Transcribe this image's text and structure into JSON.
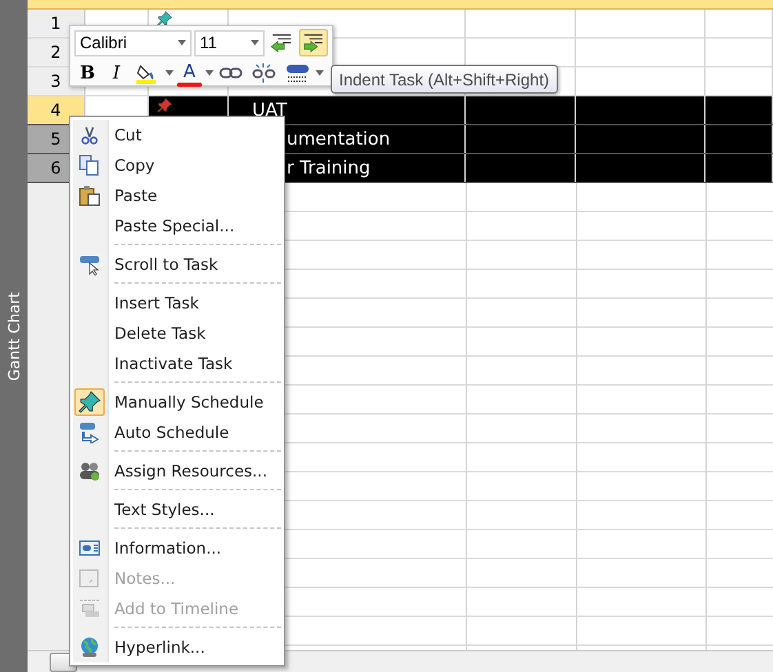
{
  "side_tab": {
    "label": "Gantt Chart"
  },
  "table": {
    "rows": [
      {
        "number": "1",
        "kind": "pinned",
        "selected": false,
        "active": false
      },
      {
        "number": "2",
        "selected": false,
        "active": false
      },
      {
        "number": "3",
        "selected": false,
        "active": false
      },
      {
        "number": "4",
        "kind": "pinned-warning",
        "name": "UAT",
        "selected": true,
        "active": true
      },
      {
        "number": "5",
        "name": "umentation",
        "selected": true,
        "active": false
      },
      {
        "number": "6",
        "name": "r Training",
        "selected": true,
        "active": false
      }
    ]
  },
  "mini_toolbar": {
    "font": "Calibri",
    "size": "11",
    "top_tools": [
      {
        "kind": "outdent",
        "hovered": false
      },
      {
        "kind": "indent",
        "hovered": true
      }
    ],
    "bottom_tools": [
      {
        "kind": "bold",
        "label": "B"
      },
      {
        "kind": "italic",
        "label": "I"
      },
      {
        "kind": "fill"
      },
      {
        "kind": "font-color",
        "label": "A"
      },
      {
        "kind": "link"
      },
      {
        "kind": "unlink"
      },
      {
        "kind": "percent"
      }
    ],
    "tooltip": "Indent Task (Alt+Shift+Right)"
  },
  "context_menu": {
    "groups": [
      [
        {
          "label": "Cut",
          "kind": "cut",
          "checked": false,
          "disabled": false
        },
        {
          "label": "Copy",
          "kind": "copy",
          "checked": false,
          "disabled": false
        },
        {
          "label": "Paste",
          "kind": "paste",
          "checked": false,
          "disabled": false
        },
        {
          "label": "Paste Special...",
          "kind": "plain",
          "checked": false,
          "disabled": false
        }
      ],
      [
        {
          "label": "Scroll to Task",
          "kind": "scroll",
          "checked": false,
          "disabled": false
        }
      ],
      [
        {
          "label": "Insert Task",
          "kind": "plain",
          "checked": false,
          "disabled": false
        },
        {
          "label": "Delete Task",
          "kind": "plain",
          "checked": false,
          "disabled": false
        },
        {
          "label": "Inactivate Task",
          "kind": "plain",
          "checked": false,
          "disabled": false
        }
      ],
      [
        {
          "label": "Manually Schedule",
          "kind": "pin",
          "checked": true,
          "disabled": false
        },
        {
          "label": "Auto Schedule",
          "kind": "auto",
          "checked": false,
          "disabled": false
        }
      ],
      [
        {
          "label": "Assign Resources...",
          "kind": "people",
          "checked": false,
          "disabled": false
        }
      ],
      [
        {
          "label": "Text Styles...",
          "kind": "plain",
          "checked": false,
          "disabled": false
        }
      ],
      [
        {
          "label": "Information...",
          "kind": "info",
          "checked": false,
          "disabled": false
        },
        {
          "label": "Notes...",
          "kind": "note",
          "checked": false,
          "disabled": true
        },
        {
          "label": "Add to Timeline",
          "kind": "timeline",
          "checked": false,
          "disabled": true
        }
      ],
      [
        {
          "label": "Hyperlink...",
          "kind": "globe",
          "checked": false,
          "disabled": false
        }
      ]
    ]
  }
}
